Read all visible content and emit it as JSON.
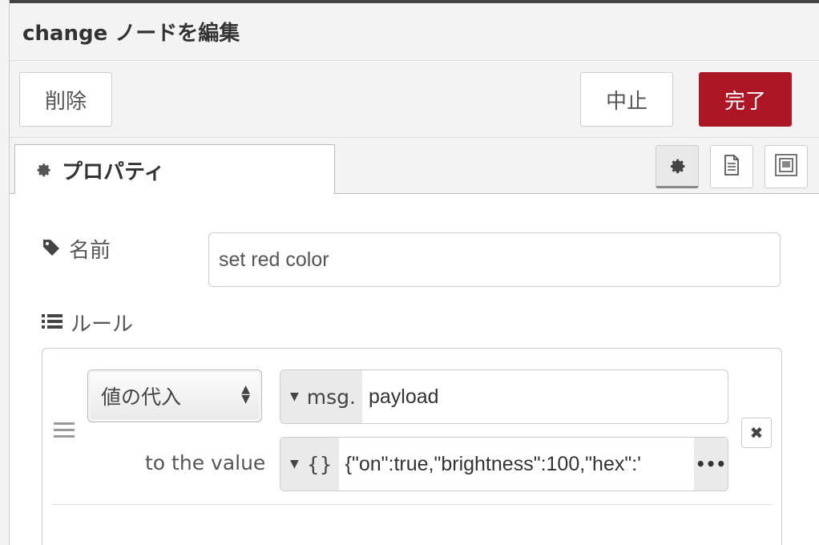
{
  "dialog": {
    "title": "change ノードを編集"
  },
  "toolbar": {
    "delete_label": "削除",
    "cancel_label": "中止",
    "done_label": "完了"
  },
  "tabs": [
    {
      "label": "プロパティ",
      "icon": "gear-icon"
    }
  ],
  "tab_icons": [
    "gear-icon",
    "document-icon",
    "appearance-icon"
  ],
  "form": {
    "name_label": "名前",
    "name_value": "set red color",
    "rules_label": "ルール"
  },
  "rule": {
    "action": "値の代入",
    "target_type": "msg.",
    "target_value": "payload",
    "to_label": "to the value",
    "value_type": "{}",
    "value": "{\"on\":true,\"brightness\":100,\"hex\":'",
    "expand": "•••",
    "remove": "✖"
  },
  "colors": {
    "primary": "#ad1625"
  }
}
